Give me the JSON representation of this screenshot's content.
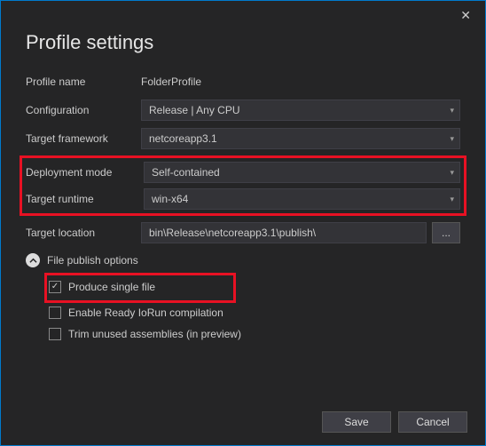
{
  "title": "Profile settings",
  "fields": {
    "profile_name": {
      "label": "Profile name",
      "value": "FolderProfile"
    },
    "configuration": {
      "label": "Configuration",
      "value": "Release | Any CPU"
    },
    "target_framework": {
      "label": "Target framework",
      "value": "netcoreapp3.1"
    },
    "deployment_mode": {
      "label": "Deployment mode",
      "value": "Self-contained"
    },
    "target_runtime": {
      "label": "Target runtime",
      "value": "win-x64"
    },
    "target_location": {
      "label": "Target location",
      "value": "bin\\Release\\netcoreapp3.1\\publish\\"
    }
  },
  "browse_label": "...",
  "expander": {
    "label": "File publish options"
  },
  "options": {
    "single_file": {
      "label": "Produce single file",
      "checked": true
    },
    "ready_to_run": {
      "label": "Enable Ready IoRun compilation",
      "checked": false
    },
    "trim": {
      "label": "Trim unused assemblies (in preview)",
      "checked": false
    }
  },
  "footer": {
    "save": "Save",
    "cancel": "Cancel"
  }
}
